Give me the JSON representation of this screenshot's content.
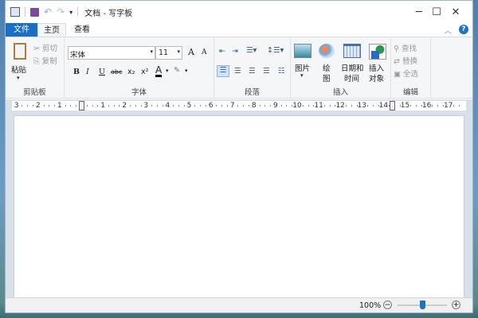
{
  "window": {
    "title": "文档 - 写字板"
  },
  "tabs": [
    {
      "label": "文件"
    },
    {
      "label": "主页"
    },
    {
      "label": "查看"
    }
  ],
  "clipboard": {
    "paste": "粘贴",
    "cut": "剪切",
    "copy": "复制",
    "group": "剪贴板"
  },
  "font": {
    "family": "宋体",
    "size": "11",
    "group": "字体",
    "bold": "B",
    "italic": "I",
    "underline": "U",
    "strike": "abc",
    "sub": "x₂",
    "sup": "x²",
    "grow": "A",
    "shrink": "A",
    "color_letter": "A"
  },
  "paragraph": {
    "group": "段落"
  },
  "insert": {
    "picture": "图片",
    "paint_l1": "绘",
    "paint_l2": "图",
    "datetime_l1": "日期和",
    "datetime_l2": "时间",
    "object_l1": "插入",
    "object_l2": "对象",
    "group": "插入"
  },
  "editing": {
    "find": "查找",
    "replace": "替换",
    "select_all": "全选",
    "group": "编辑"
  },
  "ruler": {
    "left_numbers": [
      "3",
      "2",
      "1"
    ],
    "right_numbers": [
      "1",
      "2",
      "3",
      "4",
      "5",
      "6",
      "7",
      "8",
      "9",
      "10",
      "11",
      "12",
      "13",
      "14",
      "15",
      "16",
      "17"
    ]
  },
  "status": {
    "zoom": "100%",
    "zoom_level": 100
  },
  "colors": {
    "file_tab": "#1a6fc4",
    "accent": "#1e73be"
  }
}
